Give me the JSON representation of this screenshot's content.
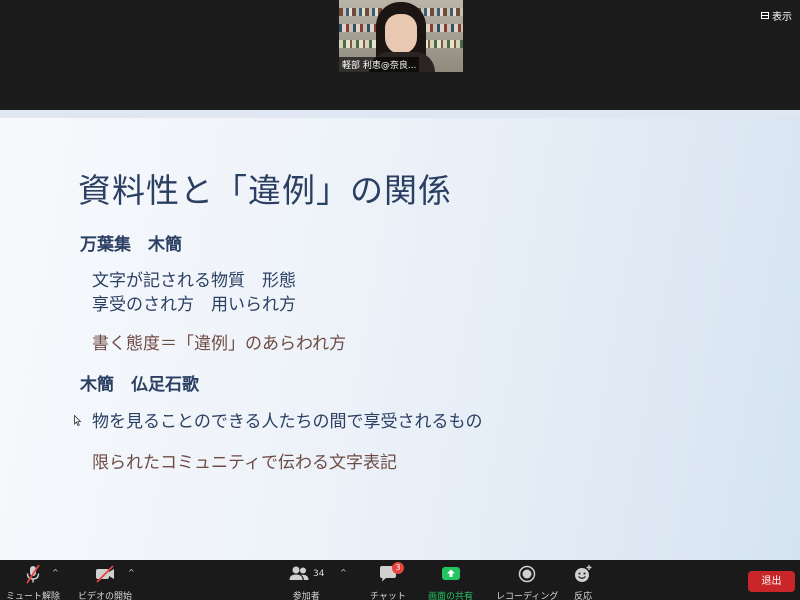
{
  "video": {
    "participant_name": "軽部 利恵@奈良..."
  },
  "header": {
    "view_label": "表示"
  },
  "slide": {
    "title": "資料性と「違例」の関係",
    "section1_heading": "万葉集　木簡",
    "section1_line1": "文字が記される物質　形態",
    "section1_line2": "享受のされ方　用いられ方",
    "section1_line3": "書く態度＝「違例」のあらわれ方",
    "section2_heading": "木簡　仏足石歌",
    "section2_line1": "物を見ることのできる人たちの間で享受されるもの",
    "section2_line2": "限られたコミュニティで伝わる文字表記"
  },
  "toolbar": {
    "unmute_label": "ミュート解除",
    "start_video_label": "ビデオの開始",
    "participants_label": "参加者",
    "participants_count": "34",
    "chat_label": "チャット",
    "chat_badge": "3",
    "share_screen_label": "画面の共有",
    "recording_label": "レコーディング",
    "reactions_label": "反応",
    "leave_label": "退出"
  },
  "colors": {
    "toolbar_bg": "#1a1a1a",
    "share_green": "#24c461",
    "leave_red": "#c9262a",
    "slide_text": "#2b3f63",
    "slide_brown": "#6e4b45"
  }
}
